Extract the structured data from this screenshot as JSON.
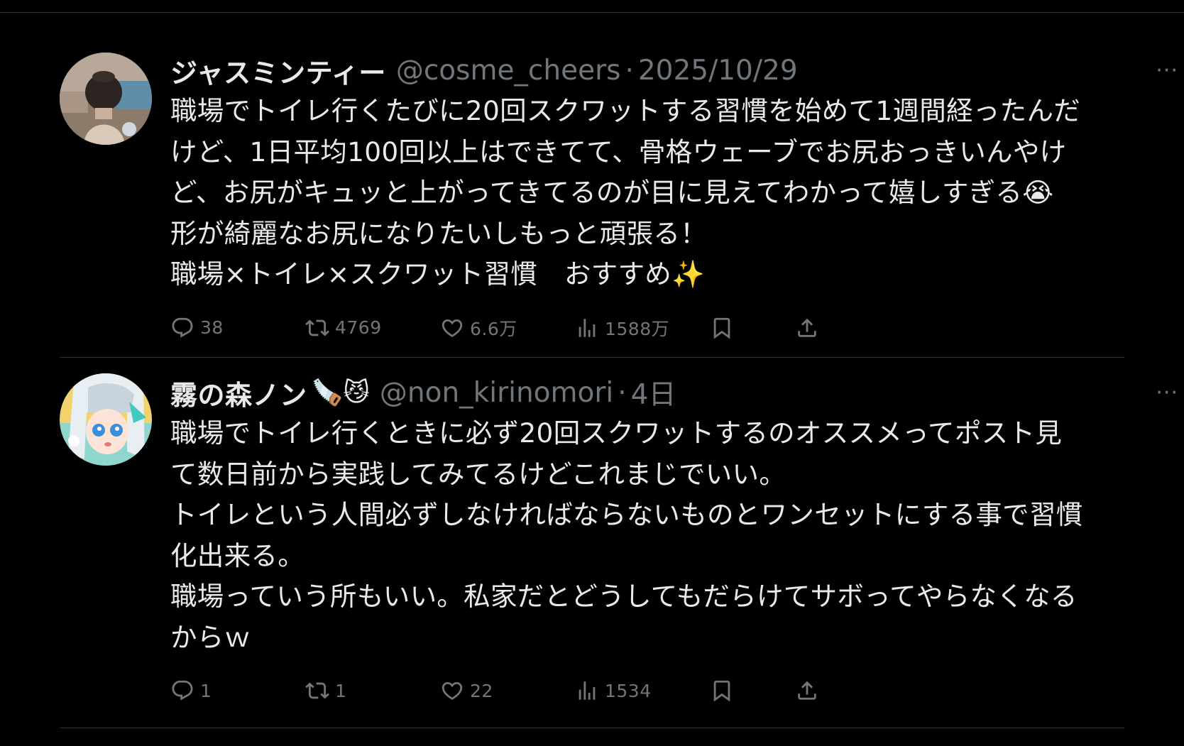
{
  "posts": [
    {
      "display_name": "ジャスミンティー",
      "name_emojis": "",
      "handle": "@cosme_cheers",
      "separator": "·",
      "date": "2025/10/29",
      "more_label": "···",
      "body_lines": [
        "職場でトイレ行くたびに20回スクワットする習慣を始めて1週間経ったんだ",
        "けど、1日平均100回以上はできてて、骨格ウェーブでお尻おっきいんやけ",
        "ど、お尻がキュッと上がってきてるのが目に見えてわかって嬉しすぎる😭",
        "形が綺麗なお尻になりたいしもっと頑張る！",
        "職場×トイレ×スクワット習慣　おすすめ✨"
      ],
      "metrics": {
        "replies": "38",
        "reposts": "4769",
        "likes": "6.6万",
        "views": "1588万"
      },
      "avatar_colors": {
        "bg": "#6b5a4e",
        "hair": "#2b2420",
        "accent": "#d9c9b8"
      }
    },
    {
      "display_name": "霧の森ノン",
      "name_emojis": "🪚😼",
      "handle": "@non_kirinomori",
      "separator": "·",
      "date": "4日",
      "more_label": "···",
      "body_lines": [
        "職場でトイレ行くときに必ず20回スクワットするのオススメってポスト見",
        "て数日前から実践してみてるけどこれまじでいい。",
        "トイレという人間必ずしなければならないものとワンセットにする事で習慣",
        "化出来る。",
        "職場っていう所もいい。私家だとどうしてもだらけてサボってやらなくなる",
        "からｗ"
      ],
      "metrics": {
        "replies": "1",
        "reposts": "1",
        "likes": "22",
        "views": "1534"
      },
      "avatar_colors": {
        "bg": "#f2d36b",
        "hair": "#e9eef2",
        "accent": "#43c9c0"
      }
    }
  ],
  "theme": {
    "background": "#000000",
    "text": "#e7e9ea",
    "muted": "#71767b",
    "divider": "#2f3336"
  }
}
